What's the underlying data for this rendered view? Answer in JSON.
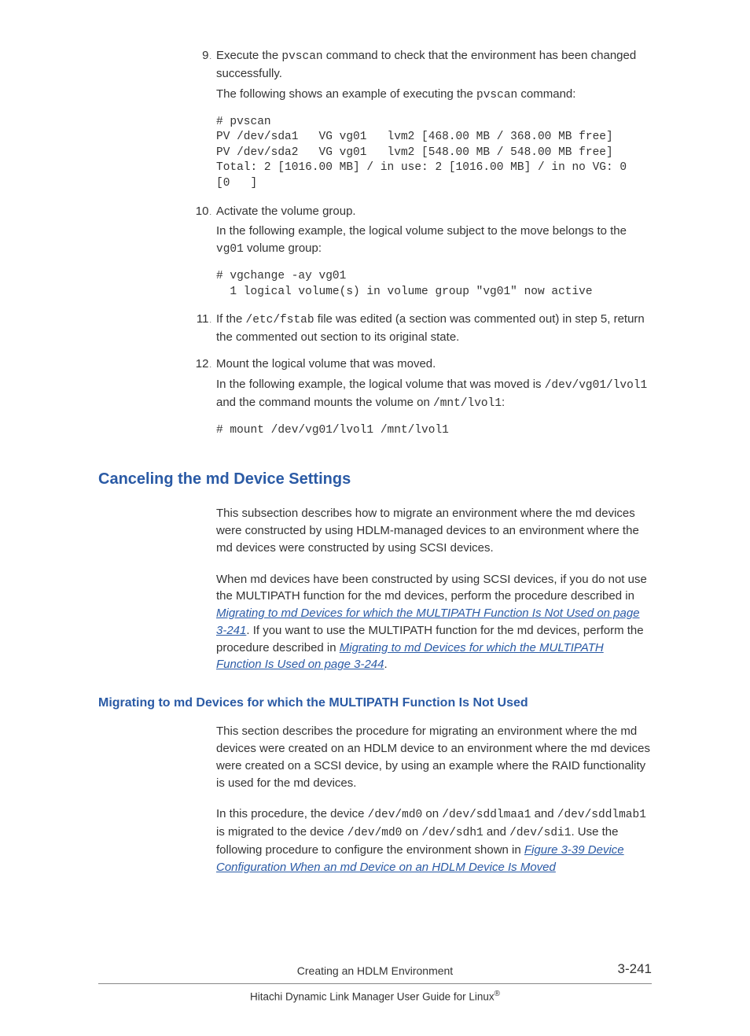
{
  "steps": {
    "s9": {
      "num": "9",
      "line1a": "Execute the ",
      "line1_code": "pvscan",
      "line1b": " command to check that the environment has been changed successfully.",
      "line2a": "The following shows an example of executing the ",
      "line2_code": "pvscan",
      "line2b": " command:",
      "code": "# pvscan\nPV /dev/sda1   VG vg01   lvm2 [468.00 MB / 368.00 MB free]\nPV /dev/sda2   VG vg01   lvm2 [548.00 MB / 548.00 MB free]\nTotal: 2 [1016.00 MB] / in use: 2 [1016.00 MB] / in no VG: 0 \n[0   ]"
    },
    "s10": {
      "num": "10",
      "line1": "Activate the volume group.",
      "line2a": "In the following example, the logical volume subject to the move belongs to the ",
      "line2_code": "vg01",
      "line2b": " volume group:",
      "code": "# vgchange -ay vg01\n  1 logical volume(s) in volume group \"vg01\" now active"
    },
    "s11": {
      "num": "11",
      "line1a": "If the ",
      "line1_code": "/etc/fstab",
      "line1b": " file was edited (a section was commented out) in step 5, return the commented out section to its original state."
    },
    "s12": {
      "num": "12",
      "line1": "Mount the logical volume that was moved.",
      "line2a": "In the following example, the logical volume that was moved is ",
      "line2_code1": "/dev/vg01/lvol1",
      "line2b": " and the command mounts the volume on ",
      "line2_code2": "/mnt/lvol1",
      "line2c": ":",
      "code": "# mount /dev/vg01/lvol1 /mnt/lvol1"
    }
  },
  "section": {
    "title": "Canceling the md Device Settings",
    "p1": "This subsection describes how to migrate an environment where the md devices were constructed by using HDLM-managed devices to an environment where the md devices were constructed by using SCSI devices.",
    "p2a": "When md devices have been constructed by using SCSI devices, if you do not use the MULTIPATH function for the md devices, perform the procedure described in ",
    "p2_link1": "Migrating to md Devices for which the MULTIPATH Function Is Not Used on page 3-241",
    "p2b": ". If you want to use the MULTIPATH function for the md devices, perform the procedure described in ",
    "p2_link2": "Migrating to md Devices for which the MULTIPATH Function Is Used on page 3-244",
    "p2c": "."
  },
  "subsection": {
    "title": "Migrating to md Devices for which the MULTIPATH Function Is Not Used",
    "p1": "This section describes the procedure for migrating an environment where the md devices were created on an HDLM device to an environment where the md devices were created on a SCSI device, by using an example where the RAID functionality is used for the md devices.",
    "p2a": "In this procedure, the device ",
    "p2_c1": "/dev/md0",
    "p2b": " on ",
    "p2_c2": "/dev/sddlmaa1",
    "p2c": " and ",
    "p2_c3": "/dev/sddlmab1",
    "p2d": " is migrated to the device ",
    "p2_c4": "/dev/md0",
    "p2e": " on ",
    "p2_c5": "/dev/sdh1",
    "p2f": " and ",
    "p2_c6": "/dev/sdi1",
    "p2g": ". Use the following procedure to configure the environment shown in ",
    "p2_link": "Figure 3-39 Device Configuration When an md Device on an HDLM Device Is Moved"
  },
  "footer": {
    "chapter": "Creating an HDLM Environment",
    "page": "3-241",
    "book": "Hitachi Dynamic Link Manager User Guide for Linux"
  }
}
